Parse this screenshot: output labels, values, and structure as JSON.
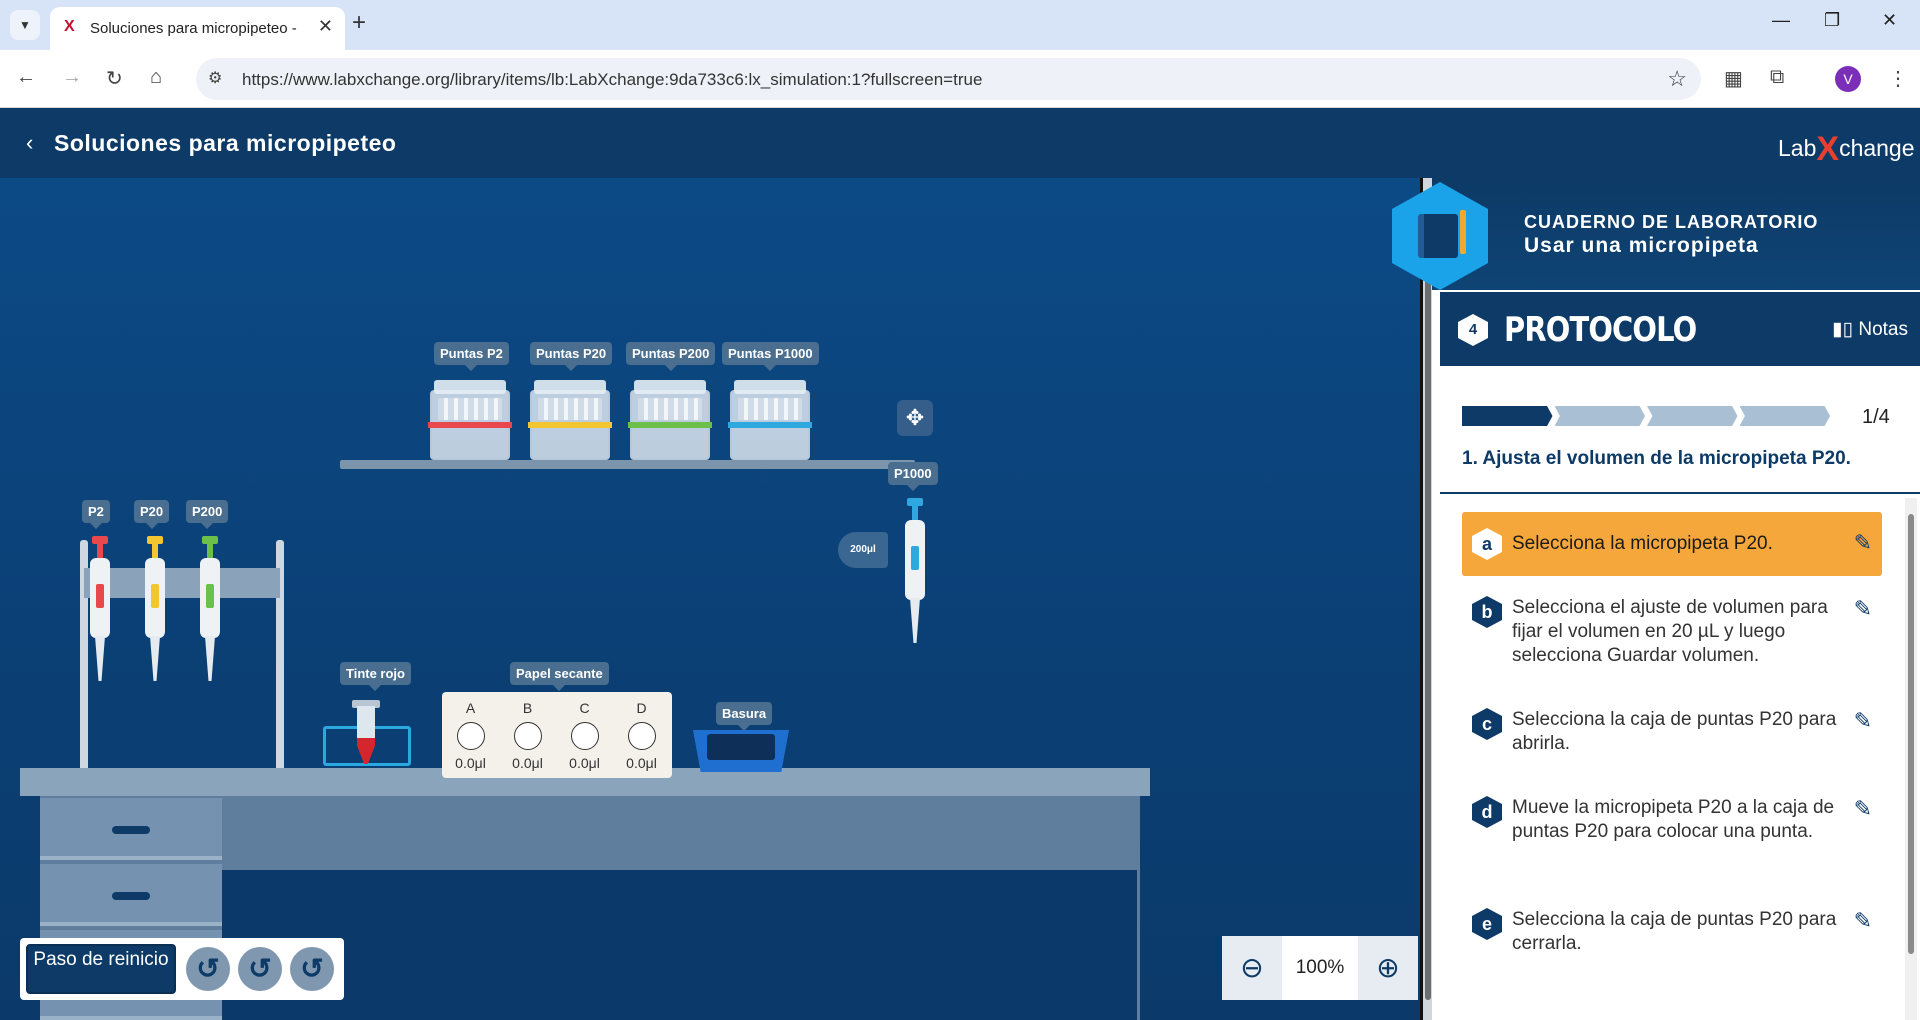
{
  "browser": {
    "tab_title": "Soluciones para micropipeteo -",
    "tab_close": "✕",
    "new_tab": "+",
    "url": "https://www.labxchange.org/library/items/lb:LabXchange:9da733c6:lx_simulation:1?fullscreen=true",
    "avatar_letter": "V",
    "minimize": "—",
    "restore": "❐",
    "close": "✕"
  },
  "app": {
    "title": "Soluciones para micropipeteo",
    "logo_lab": "Lab",
    "logo_x": "X",
    "logo_change": "change"
  },
  "sim": {
    "tip_boxes": [
      {
        "label": "Puntas P2",
        "color": "#e8474c"
      },
      {
        "label": "Puntas P20",
        "color": "#f2c531"
      },
      {
        "label": "Puntas P200",
        "color": "#6cc04a"
      },
      {
        "label": "Puntas P1000",
        "color": "#2fa8e0"
      }
    ],
    "pipettes": [
      {
        "label": "P2",
        "color": "#e8474c"
      },
      {
        "label": "P20",
        "color": "#f2c531"
      },
      {
        "label": "P200",
        "color": "#6cc04a"
      },
      {
        "label": "P1000",
        "color": "#2fa8e0"
      }
    ],
    "p1000_volume": "200μl",
    "dye_label": "Tinte rojo",
    "blotting_label": "Papel secante",
    "blot_columns": [
      {
        "letter": "A",
        "value": "0.0μl"
      },
      {
        "letter": "B",
        "value": "0.0μl"
      },
      {
        "letter": "C",
        "value": "0.0μl"
      },
      {
        "letter": "D",
        "value": "0.0μl"
      }
    ],
    "trash_label": "Basura",
    "reset_label": "Paso de reinicio",
    "zoom": "100%"
  },
  "notebook": {
    "header_small": "CUADERNO DE LABORATORIO",
    "header_large": "Usar una micropipeta",
    "section_number": "4",
    "section_title": "PROTOCOLO",
    "notes_label": "Notas",
    "progress_text": "1/4",
    "progress_fraction": 0.25,
    "colors": {
      "done": "#0d3a66",
      "todo": "#a9bfd3",
      "active_task": "#f6a73b"
    },
    "step_title": "1. Ajusta el volumen de la micropipeta P20.",
    "tasks": [
      {
        "letter": "a",
        "text": "Selecciona la micropipeta P20.",
        "active": true
      },
      {
        "letter": "b",
        "text": "Selecciona el ajuste de volumen para fijar el volumen en 20 µL y luego selecciona Guardar volumen.",
        "active": false
      },
      {
        "letter": "c",
        "text": "Selecciona la caja de puntas P20 para abrirla.",
        "active": false
      },
      {
        "letter": "d",
        "text": "Mueve la micropipeta P20 a la caja de puntas P20 para colocar una punta.",
        "active": false
      },
      {
        "letter": "e",
        "text": "Selecciona la caja de puntas P20 para cerrarla.",
        "active": false
      }
    ]
  }
}
